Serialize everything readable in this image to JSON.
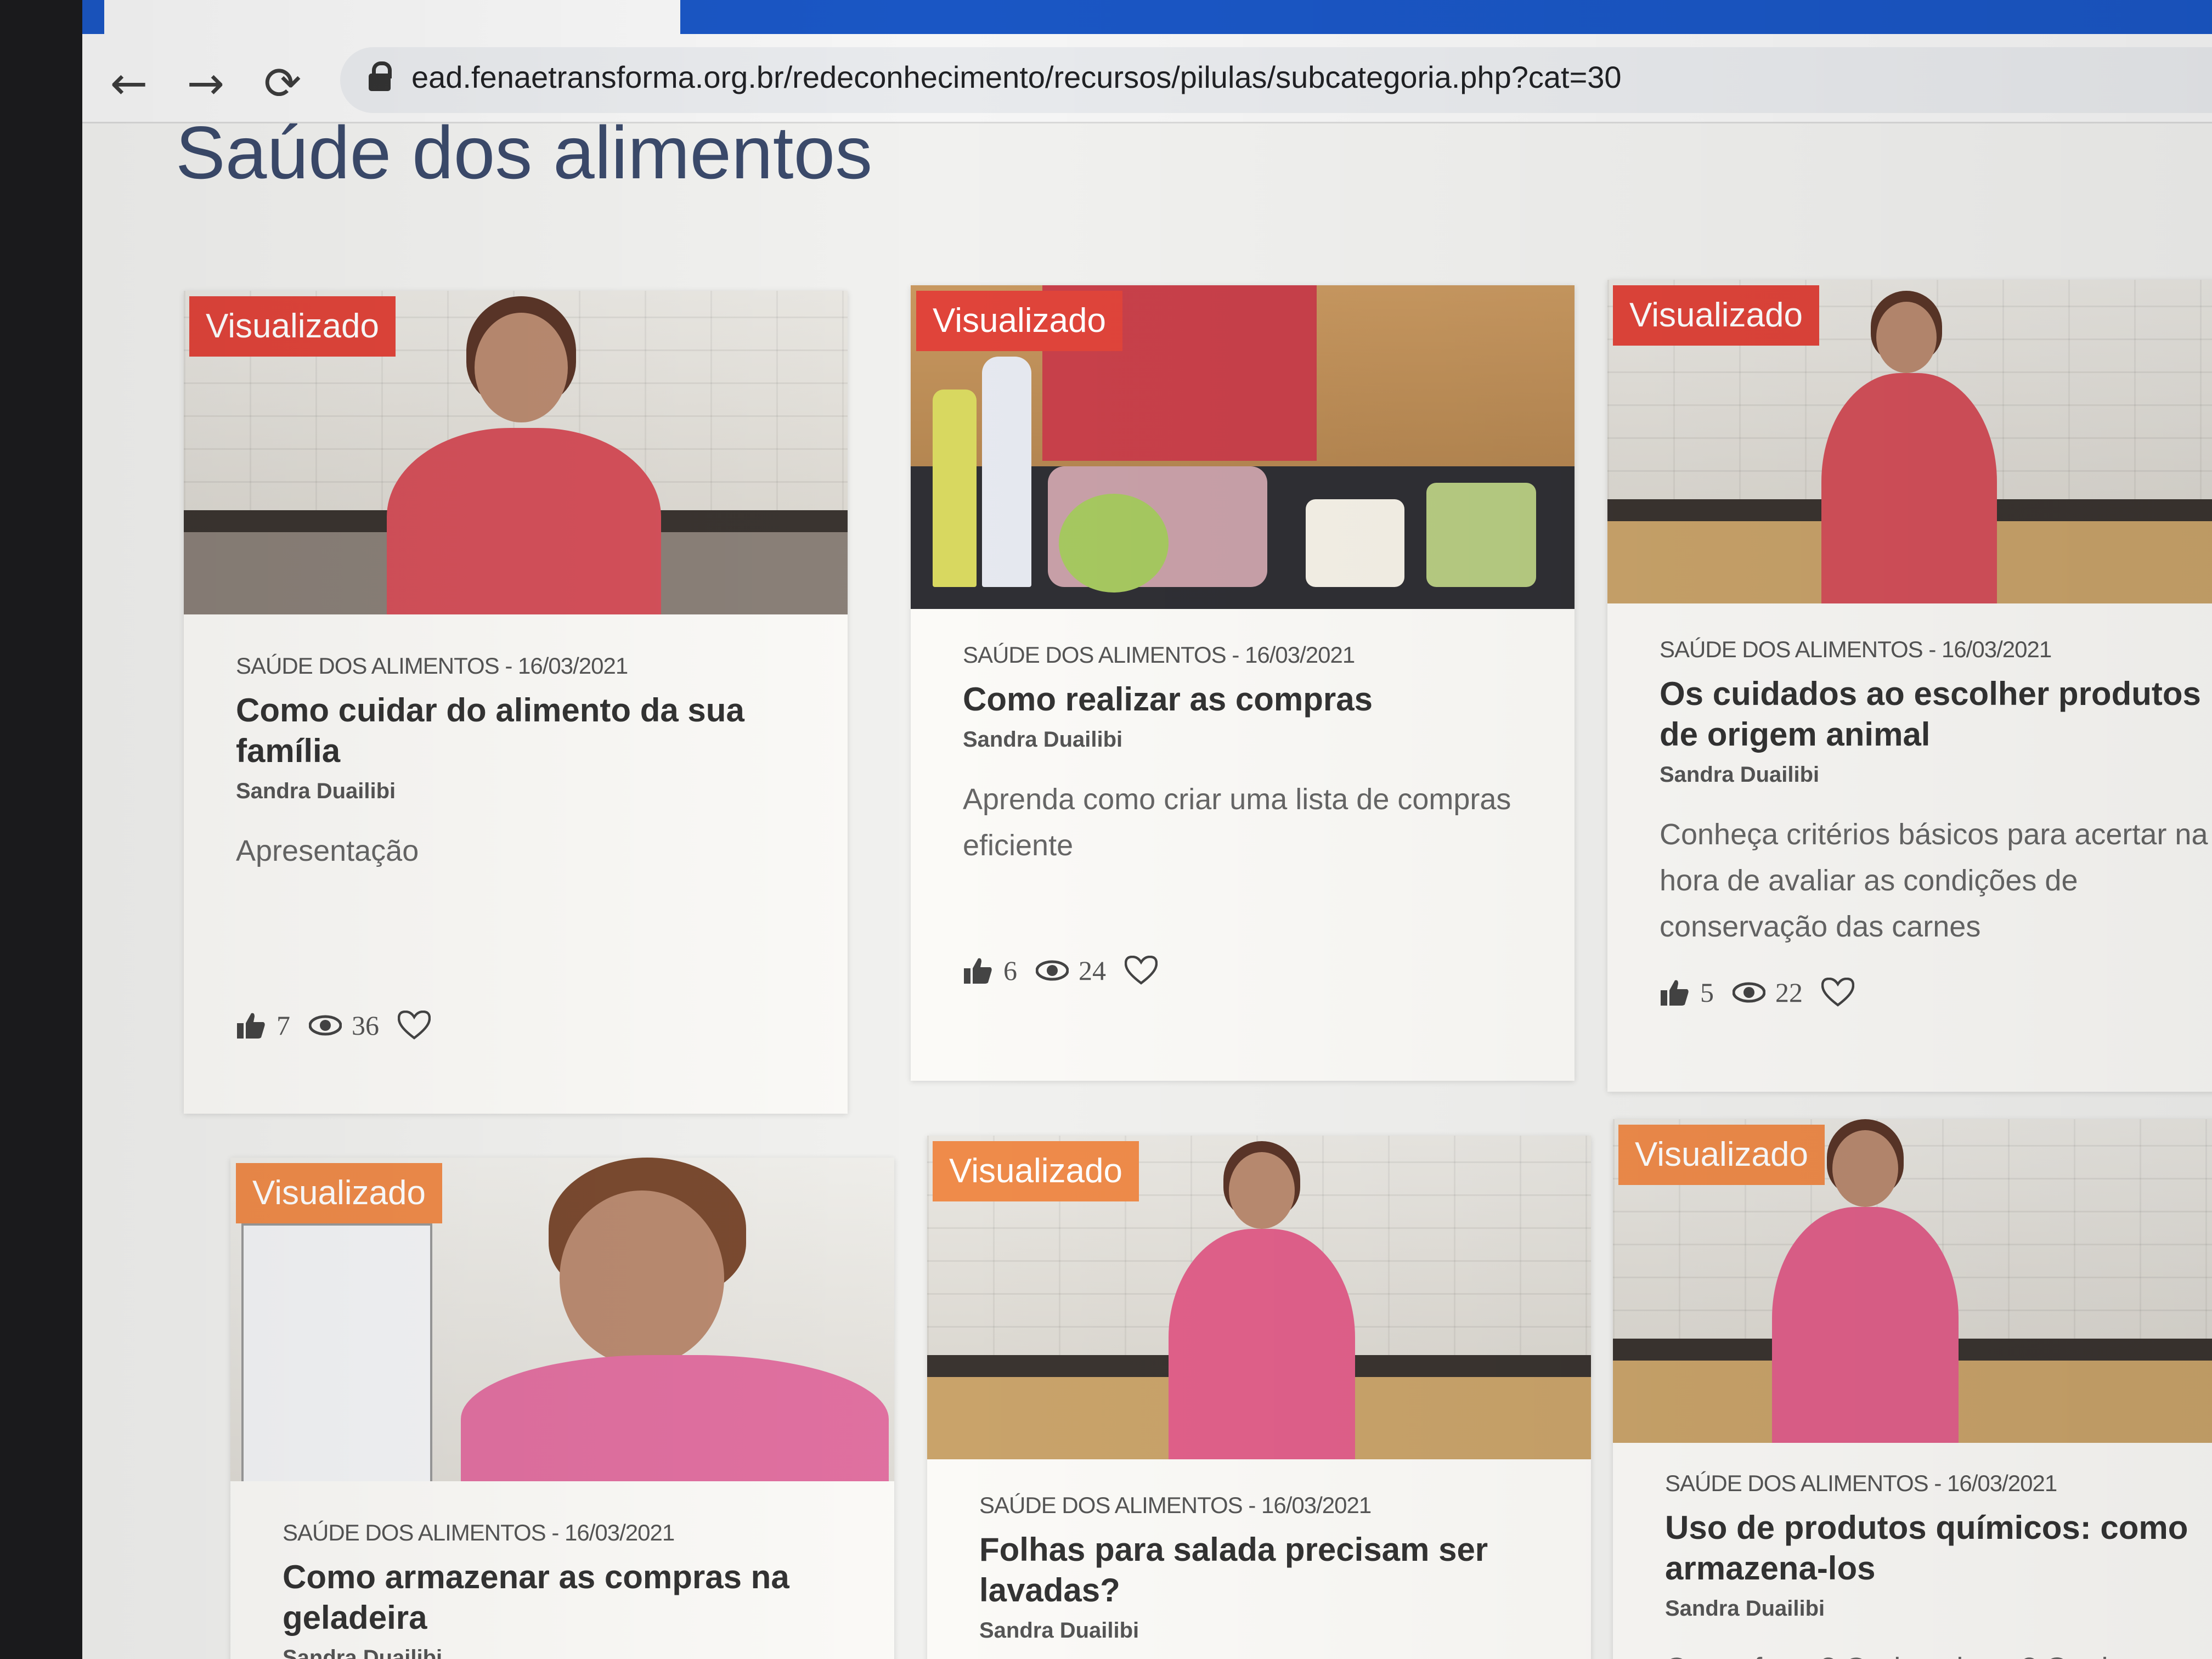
{
  "browser": {
    "url": "ead.fenaetransforma.org.br/redeconhecimento/recursos/pilulas/subcategoria.php?cat=30",
    "back_glyph": "←",
    "forward_glyph": "→",
    "reload_glyph": "⟳"
  },
  "page": {
    "title": "Saúde dos alimentos"
  },
  "cards": [
    {
      "badge": "Visualizado",
      "meta": "SAÚDE DOS ALIMENTOS - 16/03/2021",
      "title": "Como cuidar do alimento da sua família",
      "author": "Sandra Duailibi",
      "description": "Apresentação",
      "likes": "7",
      "views": "36"
    },
    {
      "badge": "Visualizado",
      "meta": "SAÚDE DOS ALIMENTOS - 16/03/2021",
      "title": "Como realizar as compras",
      "author": "Sandra Duailibi",
      "description": "Aprenda como criar uma lista de compras eficiente",
      "likes": "6",
      "views": "24"
    },
    {
      "badge": "Visualizado",
      "meta": "SAÚDE DOS ALIMENTOS - 16/03/2021",
      "title": "Os cuidados ao escolher produtos de origem animal",
      "author": "Sandra Duailibi",
      "description": "Conheça critérios básicos para acertar na hora de avaliar as condições de conservação das carnes",
      "likes": "5",
      "views": "22"
    },
    {
      "badge": "Visualizado",
      "meta": "SAÚDE DOS ALIMENTOS - 16/03/2021",
      "title": "Como armazenar as compras na geladeira",
      "author": "Sandra Duailibi"
    },
    {
      "badge": "Visualizado",
      "meta": "SAÚDE DOS ALIMENTOS - 16/03/2021",
      "title": "Folhas para salada precisam ser lavadas?",
      "author": "Sandra Duailibi"
    },
    {
      "badge": "Visualizado",
      "meta": "SAÚDE DOS ALIMENTOS - 16/03/2021",
      "title": "Uso de produtos químicos: como armazena-los",
      "author": "Sandra Duailibi",
      "description": "O que fazer? Onde colocar? Quais"
    }
  ],
  "colors": {
    "badge_red": "#e0443a",
    "badge_orange": "#ef8b4a",
    "title_blue": "#3b4a6b"
  }
}
